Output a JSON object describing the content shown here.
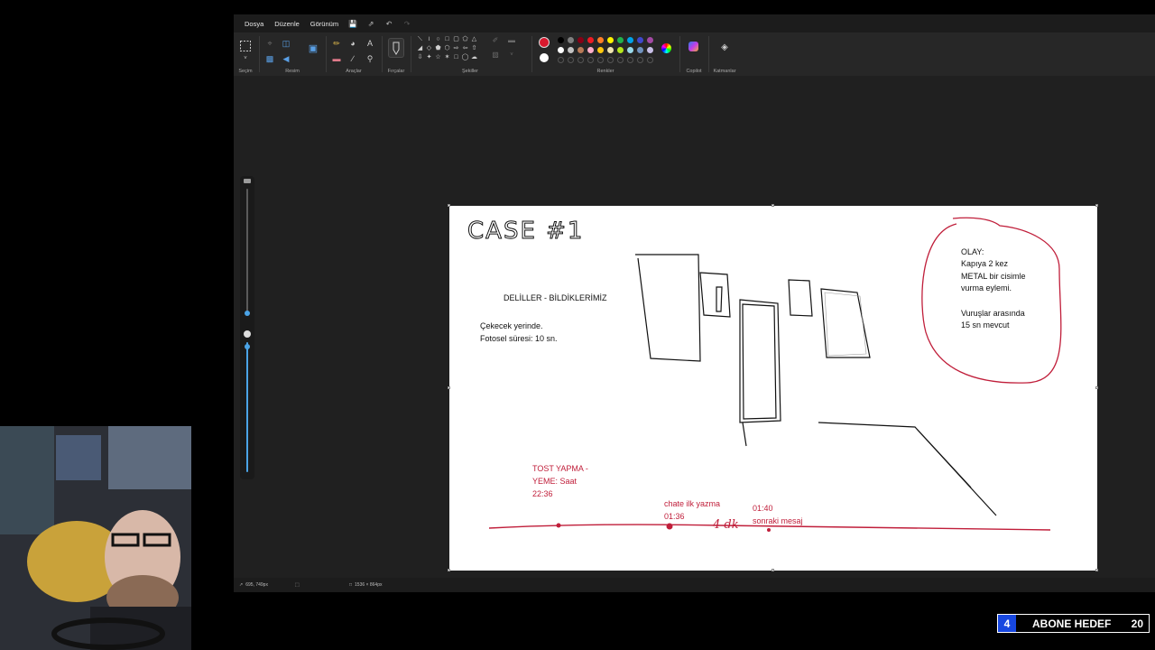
{
  "menu": {
    "file": "Dosya",
    "edit": "Düzenle",
    "view": "Görünüm"
  },
  "ribbon": {
    "selection_label": "Seçim",
    "image_label": "Resim",
    "tools_label": "Araçlar",
    "brushes_label": "Fırçalar",
    "shapes_label": "Şekiller",
    "colors_label": "Renkler",
    "copilot_label": "Copilot",
    "layers_label": "Katmanlar",
    "primary_color": "#d8192e",
    "secondary_color": "#ffffff",
    "palette_row1": [
      "#000000",
      "#7f7f7f",
      "#880015",
      "#ed1c24",
      "#ff7f27",
      "#fff200",
      "#22b14c",
      "#00a2e8",
      "#3f48cc",
      "#a349a4"
    ],
    "palette_row2": [
      "#ffffff",
      "#c3c3c3",
      "#b97a57",
      "#ffaec9",
      "#ffc90e",
      "#efe4b0",
      "#b5e61d",
      "#99d9ea",
      "#7092be",
      "#c8bfe7"
    ]
  },
  "canvas": {
    "title_handwritten": "CASE #1",
    "evidence_heading": "DELİLLER - BİLDİKLERİMİZ",
    "evidence_line1": "Çekecek yerinde.",
    "evidence_line2": "Fotosel süresi: 10 sn.",
    "event_line1": "OLAY:",
    "event_line2": "Kapıya 2 kez",
    "event_line3": "METAL bir cisimle",
    "event_line4": "vurma eylemi.",
    "event_line5": "Vuruşlar arasında",
    "event_line6": "15 sn mevcut",
    "toast_line1": "TOST YAPMA -",
    "toast_line2": "YEME: Saat",
    "toast_line3": "22:36",
    "chat_line1": "chate ilk yazma",
    "chat_line2": "01:36",
    "handwritten_4dk": "4 dk",
    "next_line1": "01:40",
    "next_line2": "sonraki mesaj"
  },
  "status": {
    "cursor_position": "695, 749px",
    "canvas_size": "1536 × 864px"
  },
  "overlay": {
    "sub_count": "4",
    "sub_label": "ABONE HEDEF",
    "sub_goal": "20"
  }
}
